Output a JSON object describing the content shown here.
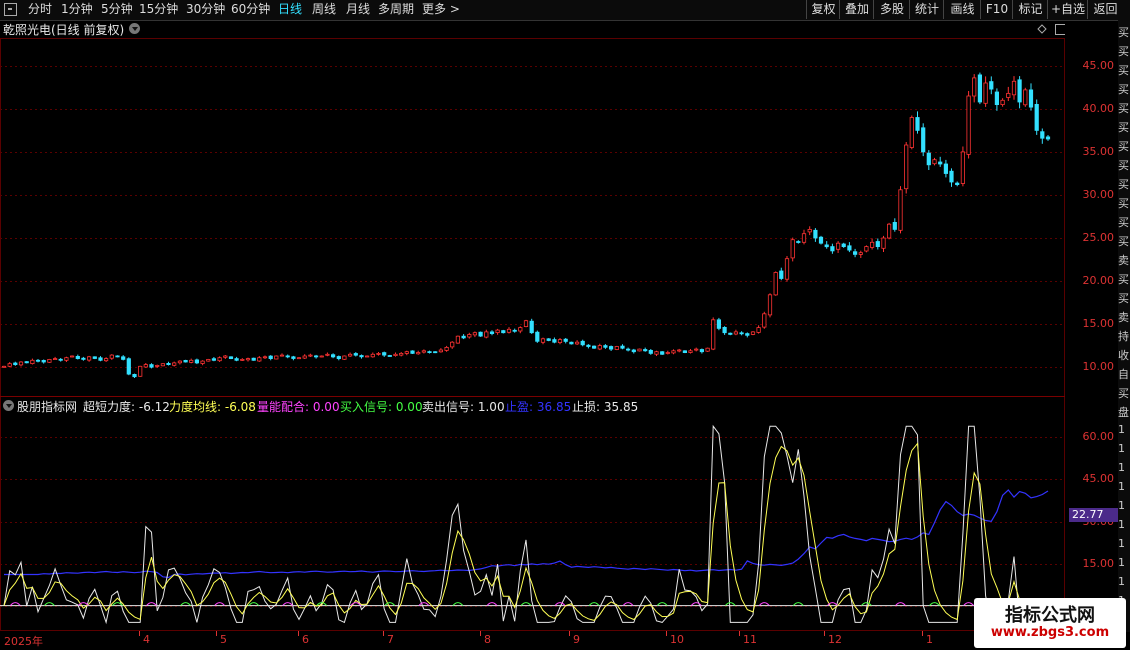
{
  "toolbar": {
    "periods": [
      "分时",
      "1分钟",
      "5分钟",
      "15分钟",
      "30分钟",
      "60分钟",
      "日线",
      "周线",
      "月线",
      "多周期",
      "更多 >"
    ],
    "active_period": "日线",
    "right_buttons": [
      "复权",
      "叠加",
      "多股",
      "统计",
      "画线",
      "F10",
      "标记",
      "+自选",
      "返回"
    ]
  },
  "chart_title": {
    "stock": "乾照光电(日线 前复权)"
  },
  "price_axis": {
    "ticks": [
      "45.00",
      "40.00",
      "35.00",
      "30.00",
      "25.00",
      "20.00",
      "15.00",
      "10.00"
    ]
  },
  "indicator": {
    "name": "股朋指标网",
    "items": [
      {
        "label": "超短力度:",
        "value": "-6.12",
        "color": "#e8e8e8"
      },
      {
        "label": "力度均线:",
        "value": "-6.08",
        "color": "#ffff55"
      },
      {
        "label": "量能配合:",
        "value": "0.00",
        "color": "#ff44ff"
      },
      {
        "label": "买入信号:",
        "value": "0.00",
        "color": "#44ff44"
      },
      {
        "label": "卖出信号:",
        "value": "1.00",
        "color": "#e8e8e8"
      },
      {
        "label": "止盈:",
        "value": "36.85",
        "color": "#3333ff"
      },
      {
        "label": "止损:",
        "value": "35.85",
        "color": "#e8e8e8"
      }
    ],
    "axis_ticks": [
      "60.00",
      "45.00",
      "30.00",
      "15.00",
      "0.00"
    ],
    "last_value": "22.77"
  },
  "x_axis": {
    "labels": [
      "2025年",
      "4",
      "5",
      "6",
      "7",
      "8",
      "9",
      "10",
      "11",
      "12",
      "1"
    ]
  },
  "sidebar_chars": [
    "买",
    "买",
    "买",
    "买",
    "买",
    "买",
    "买",
    "买",
    "买",
    "买",
    "买",
    "买",
    "卖",
    "买",
    "买",
    "卖",
    "持",
    "收",
    "自",
    "买",
    "盘",
    "1",
    "1",
    "1",
    "1",
    "1",
    "1",
    "1",
    "1",
    "1",
    "1",
    "1"
  ],
  "watermark": {
    "line1": "指标公式网",
    "line2": "www.zbgs3.com"
  },
  "colors": {
    "up": "#ff3333",
    "down": "#33e0ff",
    "grid": "#5a0000",
    "white_line": "#e8e8e8",
    "yellow_line": "#ffff55",
    "blue_line": "#3333ff"
  },
  "chart_data": {
    "type": "candlestick",
    "price_ylim": [
      7,
      48
    ],
    "price_closes": [
      10.1,
      10.4,
      10.3,
      10.6,
      10.5,
      10.8,
      10.7,
      10.6,
      10.9,
      11.0,
      10.8,
      11.1,
      11.3,
      11.0,
      10.9,
      11.2,
      11.0,
      10.8,
      11.0,
      11.4,
      11.2,
      10.9,
      9.2,
      8.9,
      10.1,
      10.3,
      10.0,
      10.2,
      10.4,
      10.3,
      10.5,
      10.7,
      10.6,
      10.8,
      10.5,
      10.7,
      10.9,
      10.8,
      11.1,
      11.3,
      11.0,
      10.8,
      10.9,
      11.0,
      10.8,
      11.1,
      11.2,
      11.0,
      11.3,
      11.4,
      11.2,
      11.0,
      11.1,
      11.3,
      11.4,
      11.2,
      11.3,
      11.5,
      11.2,
      11.0,
      11.3,
      11.5,
      11.4,
      11.2,
      11.3,
      11.5,
      11.6,
      11.4,
      11.3,
      11.5,
      11.6,
      11.8,
      11.6,
      11.7,
      11.9,
      11.8,
      11.7,
      12.0,
      12.3,
      12.9,
      13.6,
      13.4,
      13.8,
      14.0,
      13.6,
      14.1,
      13.9,
      14.3,
      14.0,
      14.4,
      14.2,
      14.6,
      15.4,
      14.0,
      13.0,
      13.3,
      13.1,
      12.9,
      13.2,
      13.0,
      12.7,
      12.9,
      12.6,
      12.4,
      12.2,
      12.5,
      12.3,
      12.1,
      12.4,
      12.2,
      12.0,
      11.8,
      12.1,
      11.9,
      11.6,
      11.8,
      11.5,
      11.7,
      11.9,
      12.0,
      11.7,
      11.9,
      12.1,
      11.8,
      12.2,
      15.5,
      14.5,
      14.0,
      13.8,
      14.1,
      13.9,
      13.7,
      14.1,
      14.6,
      16.2,
      18.4,
      21.0,
      20.3,
      22.6,
      24.8,
      24.5,
      25.5,
      26.0,
      25.0,
      24.4,
      24.0,
      23.5,
      24.4,
      24.0,
      23.6,
      23.1,
      23.3,
      24.0,
      24.5,
      24.0,
      25.0,
      26.6,
      26.0,
      30.6,
      35.8,
      39.0,
      37.5,
      35.0,
      33.5,
      34.1,
      33.6,
      32.5,
      31.5,
      31.2,
      35.0,
      41.5,
      43.6,
      40.8,
      43.0,
      42.3,
      40.5,
      41.0,
      41.8,
      43.2,
      40.8,
      42.2,
      40.2,
      37.5,
      36.6,
      36.5
    ]
  }
}
